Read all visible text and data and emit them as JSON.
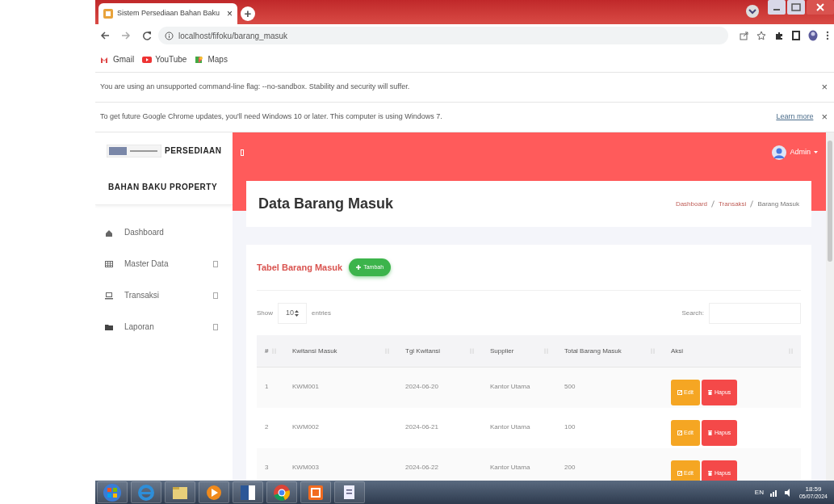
{
  "browser": {
    "tab_title": "Sistem Persediaan Bahan Baku",
    "tab_close": "×",
    "new_tab": "+",
    "url": "localhost/fifoku/barang_masuk",
    "bookmarks": [
      "Gmail",
      "YouTube",
      "Maps"
    ],
    "infobars": [
      {
        "text": "You are using an unsupported command-line flag: --no-sandbox. Stability and security will suffer.",
        "close": "×"
      },
      {
        "text": "To get future Google Chrome updates, you'll need Windows 10 or later. This computer is using Windows 7.",
        "link": "Learn more",
        "close": "×"
      }
    ]
  },
  "sidebar": {
    "brand_top": "PERSEDIAAN",
    "brand_bottom": "BAHAN BAKU PROPERTY",
    "items": [
      {
        "label": "Dashboard",
        "kind": "home",
        "expandable": false
      },
      {
        "label": "Master Data",
        "kind": "table",
        "expandable": true
      },
      {
        "label": "Transaksi",
        "kind": "laptop",
        "expandable": true
      },
      {
        "label": "Laporan",
        "kind": "folder",
        "expandable": true
      }
    ]
  },
  "topbar": {
    "user": "Admin"
  },
  "page": {
    "title": "Data Barang Masuk",
    "breadcrumb": [
      "Dashboard",
      "Transaksi",
      "Barang Masuk"
    ]
  },
  "card": {
    "title": "Tabel Barang Masuk",
    "add_button": "Tambah",
    "show_label": "Show",
    "page_size": "10",
    "entries_label": "entries",
    "search_label": "Search:",
    "table": {
      "columns": [
        "#",
        "Kwitansi Masuk",
        "Tgl Kwitansi",
        "Supplier",
        "Total Barang Masuk",
        "Aksi"
      ],
      "rows": [
        {
          "cells": [
            "1",
            "KWM001",
            "2024-06-20",
            "Kantor Utama",
            "500"
          ],
          "edit": "Edit",
          "delete": "Hapus"
        },
        {
          "cells": [
            "2",
            "KWM002",
            "2024-06-21",
            "Kantor Utama",
            "100"
          ],
          "edit": "Edit",
          "delete": "Hapus"
        },
        {
          "cells": [
            "3",
            "KWM003",
            "2024-06-22",
            "Kantor Utama",
            "200"
          ],
          "edit": "Edit",
          "delete": "Hapus"
        }
      ]
    }
  },
  "taskbar": {
    "language": "EN",
    "time": "18:59",
    "date": "05/07/2024"
  }
}
